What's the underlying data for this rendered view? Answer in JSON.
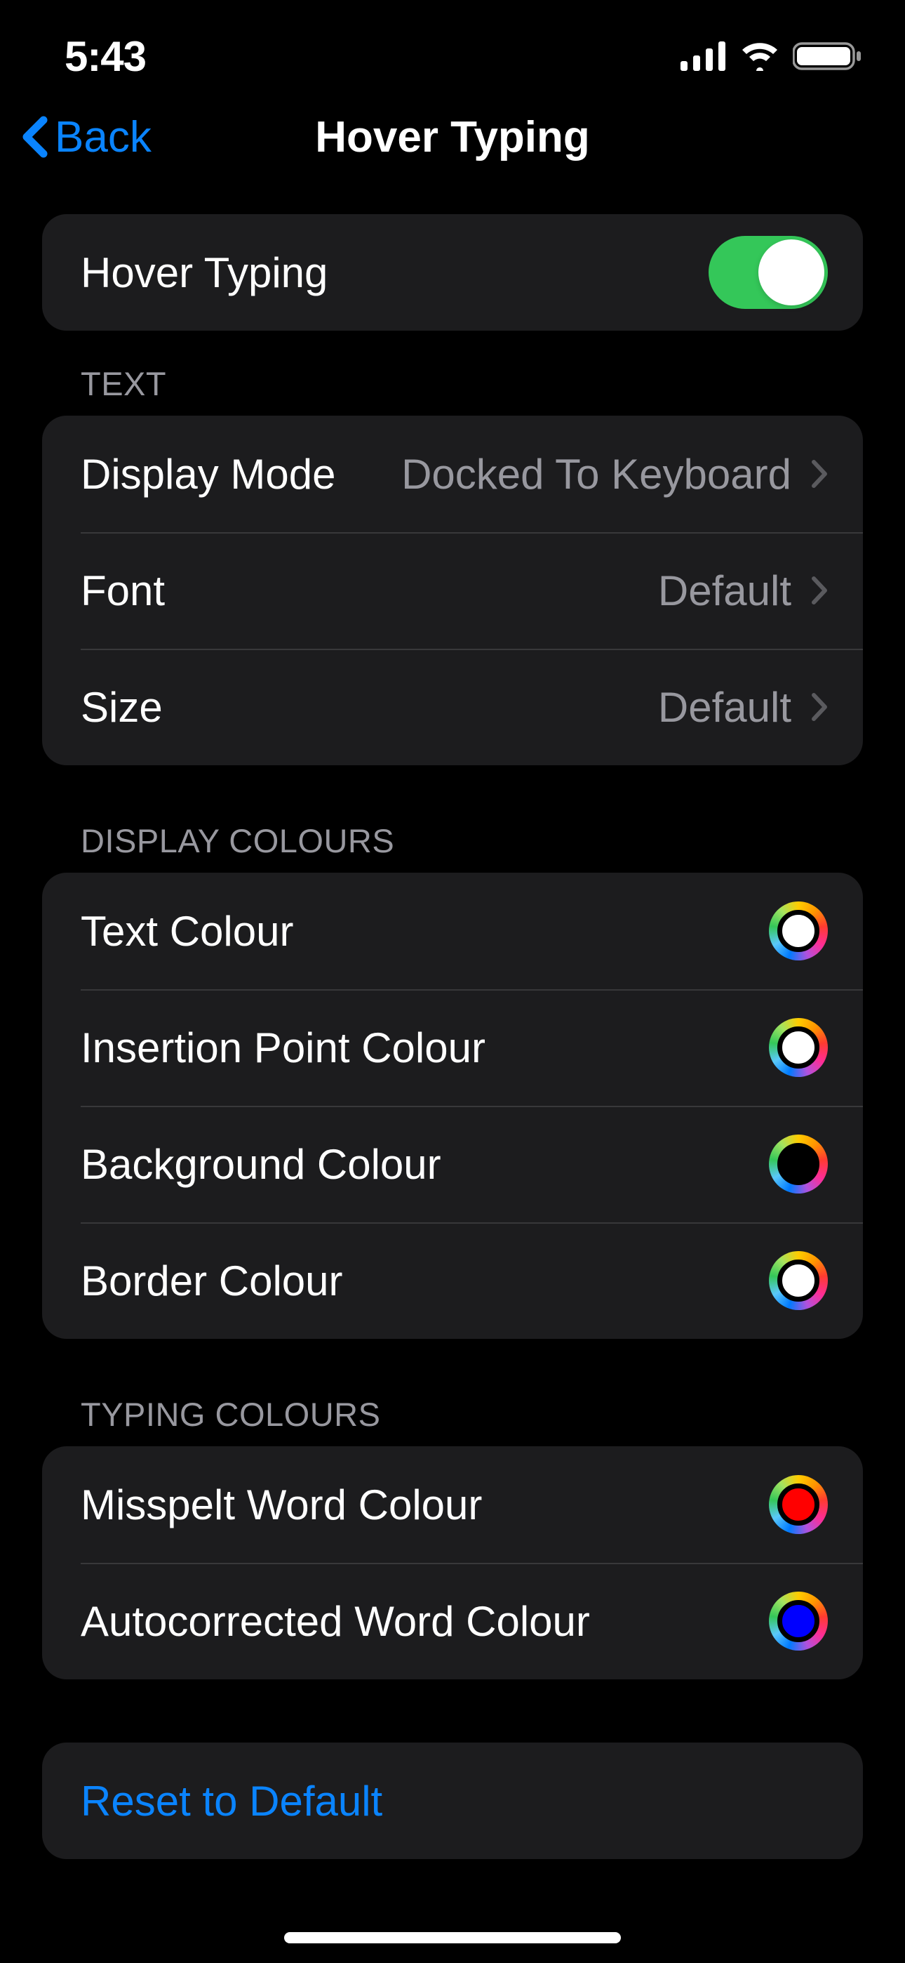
{
  "status": {
    "time": "5:43"
  },
  "nav": {
    "back_label": "Back",
    "title": "Hover Typing"
  },
  "toggle_section": {
    "label": "Hover Typing",
    "enabled": true
  },
  "text_section": {
    "header": "TEXT",
    "items": [
      {
        "label": "Display Mode",
        "value": "Docked To Keyboard"
      },
      {
        "label": "Font",
        "value": "Default"
      },
      {
        "label": "Size",
        "value": "Default"
      }
    ]
  },
  "display_colours_section": {
    "header": "DISPLAY COLOURS",
    "items": [
      {
        "label": "Text Colour",
        "color": "#ffffff"
      },
      {
        "label": "Insertion Point Colour",
        "color": "#ffffff"
      },
      {
        "label": "Background Colour",
        "color": "#000000"
      },
      {
        "label": "Border Colour",
        "color": "#ffffff"
      }
    ]
  },
  "typing_colours_section": {
    "header": "TYPING COLOURS",
    "items": [
      {
        "label": "Misspelt Word Colour",
        "color": "#ff0000"
      },
      {
        "label": "Autocorrected Word Colour",
        "color": "#0000ff"
      }
    ]
  },
  "reset": {
    "label": "Reset to Default"
  }
}
